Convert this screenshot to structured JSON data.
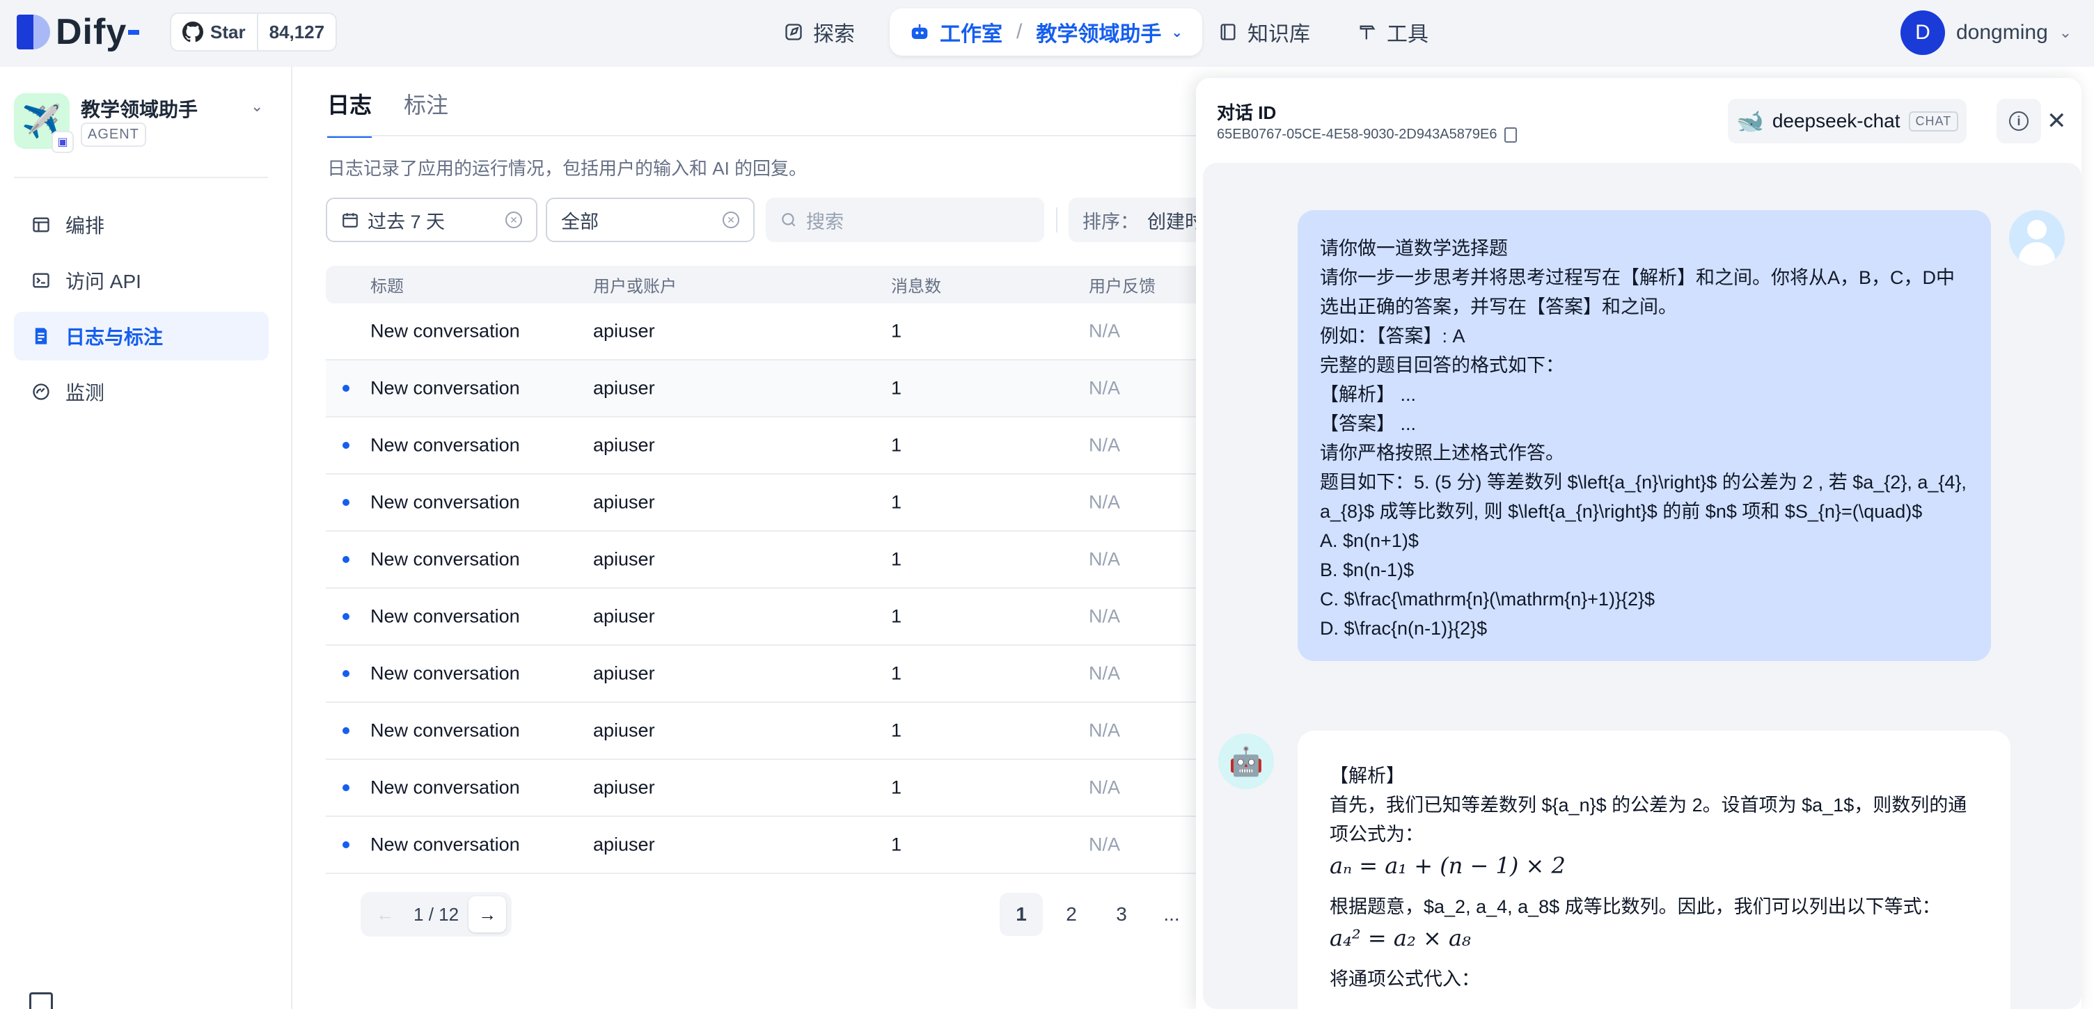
{
  "brand": {
    "name": "Dify"
  },
  "github": {
    "star_label": "Star",
    "count": "84,127"
  },
  "nav": {
    "explore": "探索",
    "studio": "工作室",
    "current_app": "教学领域助手",
    "knowledge": "知识库",
    "tools": "工具"
  },
  "user": {
    "initial": "D",
    "name": "dongming"
  },
  "sidebar": {
    "app_name": "教学领域助手",
    "app_type": "AGENT",
    "items": [
      {
        "label": "编排",
        "icon": "layout-icon"
      },
      {
        "label": "访问 API",
        "icon": "terminal-icon"
      },
      {
        "label": "日志与标注",
        "icon": "file-list-icon",
        "active": true
      },
      {
        "label": "监测",
        "icon": "dashboard-icon"
      }
    ]
  },
  "main": {
    "tabs": [
      "日志",
      "标注"
    ],
    "description": "日志记录了应用的运行情况，包括用户的输入和 AI 的回复。",
    "filters": {
      "date": "过去 7 天",
      "status": "全部",
      "search_placeholder": "搜索",
      "sort_label": "排序：",
      "sort_value": "创建时"
    },
    "table": {
      "columns": [
        "标题",
        "用户或账户",
        "消息数",
        "用户反馈"
      ],
      "rows": [
        {
          "title": "New conversation",
          "user": "apiuser",
          "messages": "1",
          "feedback": "N/A",
          "unread": false
        },
        {
          "title": "New conversation",
          "user": "apiuser",
          "messages": "1",
          "feedback": "N/A",
          "unread": true
        },
        {
          "title": "New conversation",
          "user": "apiuser",
          "messages": "1",
          "feedback": "N/A",
          "unread": true
        },
        {
          "title": "New conversation",
          "user": "apiuser",
          "messages": "1",
          "feedback": "N/A",
          "unread": true
        },
        {
          "title": "New conversation",
          "user": "apiuser",
          "messages": "1",
          "feedback": "N/A",
          "unread": true
        },
        {
          "title": "New conversation",
          "user": "apiuser",
          "messages": "1",
          "feedback": "N/A",
          "unread": true
        },
        {
          "title": "New conversation",
          "user": "apiuser",
          "messages": "1",
          "feedback": "N/A",
          "unread": true
        },
        {
          "title": "New conversation",
          "user": "apiuser",
          "messages": "1",
          "feedback": "N/A",
          "unread": true
        },
        {
          "title": "New conversation",
          "user": "apiuser",
          "messages": "1",
          "feedback": "N/A",
          "unread": true
        },
        {
          "title": "New conversation",
          "user": "apiuser",
          "messages": "1",
          "feedback": "N/A",
          "unread": true
        }
      ]
    },
    "pagination": {
      "current": "1",
      "total": "12",
      "pages": [
        "1",
        "2",
        "3",
        "..."
      ]
    }
  },
  "drawer": {
    "id_label": "对话 ID",
    "conversation_id": "65EB0767-05CE-4E58-9030-2D943A5879E6",
    "model_name": "deepseek-chat",
    "model_tag": "CHAT",
    "user_message": [
      "请你做一道数学选择题",
      "请你一步一步思考并将思考过程写在【解析】和之间。你将从A，B，C，D中选出正确的答案，并写在【答案】和之间。",
      "例如：【答案】: A",
      "完整的题目回答的格式如下：",
      "【解析】 ...",
      "【答案】 ...",
      "请你严格按照上述格式作答。",
      "题目如下：5. (5 分) 等差数列 $\\left{a_{n}\\right}$ 的公差为 2 , 若 $a_{2}, a_{4}, a_{8}$ 成等比数列, 则 $\\left{a_{n}\\right}$ 的前 $n$ 项和 $S_{n}=(\\quad)$",
      "A. $n(n+1)$",
      "B. $n(n-1)$",
      "C. $\\frac{\\mathrm{n}(\\mathrm{n}+1)}{2}$",
      "D. $\\frac{n(n-1)}{2}$"
    ],
    "bot_message": {
      "heading": "【解析】",
      "p1": "首先，我们已知等差数列 ${a_n}$ 的公差为 2。设首项为 $a_1$，则数列的通项公式为：",
      "formula1": "aₙ = a₁ + (n − 1) × 2",
      "p2": "根据题意，$a_2, a_4, a_8$ 成等比数列。因此，我们可以列出以下等式：",
      "formula2": "a₄² = a₂ × a₈",
      "p3": "将通项公式代入："
    }
  }
}
